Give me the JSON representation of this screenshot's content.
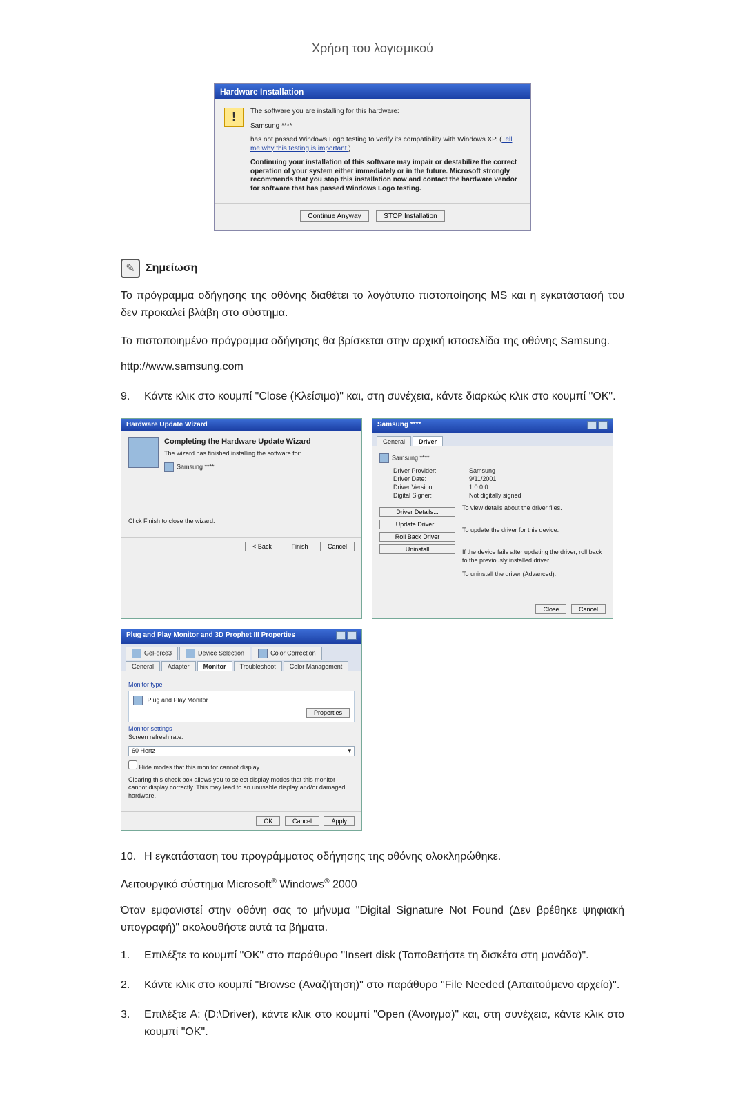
{
  "header": {
    "title": "Χρήση του λογισμικού"
  },
  "install_dialog": {
    "title": "Hardware Installation",
    "line1": "The software you are installing for this hardware:",
    "device": "Samsung ****",
    "line2a": "has not passed Windows Logo testing to verify its compatibility with Windows XP. (",
    "link": "Tell me why this testing is important.",
    "line2b": ")",
    "warn": "Continuing your installation of this software may impair or destabilize the correct operation of your system either immediately or in the future. Microsoft strongly recommends that you stop this installation now and contact the hardware vendor for software that has passed Windows Logo testing.",
    "btn_continue": "Continue Anyway",
    "btn_stop": "STOP Installation"
  },
  "note": {
    "label": "Σημείωση",
    "p1": "Το πρόγραμμα οδήγησης της οθόνης διαθέτει το λογότυπο πιστοποίησης MS και η εγκατάστασή του δεν προκαλεί βλάβη στο σύστημα.",
    "p2": "Το πιστοποιημένο πρόγραμμα οδήγησης θα βρίσκεται στην αρχική ιστοσελίδα της οθόνης Samsung.",
    "url": "http://www.samsung.com"
  },
  "step9": {
    "n": "9.",
    "t": "Κάντε κλικ στο κουμπί \"Close (Κλείσιμο)\" και, στη συνέχεια, κάντε διαρκώς κλικ στο κουμπί \"OK\"."
  },
  "wizard": {
    "title": "Hardware Update Wizard",
    "h": "Completing the Hardware Update Wizard",
    "p1": "The wizard has finished installing the software for:",
    "device": "Samsung ****",
    "p2": "Click Finish to close the wizard.",
    "back": "< Back",
    "finish": "Finish",
    "cancel": "Cancel"
  },
  "driver_props": {
    "title": "Samsung ****",
    "tab_general": "General",
    "tab_driver": "Driver",
    "device": "Samsung ****",
    "provider_k": "Driver Provider:",
    "provider_v": "Samsung",
    "date_k": "Driver Date:",
    "date_v": "9/11/2001",
    "version_k": "Driver Version:",
    "version_v": "1.0.0.0",
    "signer_k": "Digital Signer:",
    "signer_v": "Not digitally signed",
    "btn_details": "Driver Details...",
    "btn_details_t": "To view details about the driver files.",
    "btn_update": "Update Driver...",
    "btn_update_t": "To update the driver for this device.",
    "btn_rollback": "Roll Back Driver",
    "btn_rollback_t": "If the device fails after updating the driver, roll back to the previously installed driver.",
    "btn_uninstall": "Uninstall",
    "btn_uninstall_t": "To uninstall the driver (Advanced).",
    "close": "Close",
    "cancel": "Cancel"
  },
  "monitor_props": {
    "title": "Plug and Play Monitor and 3D Prophet III Properties",
    "tabs": {
      "geforce": "GeForce3",
      "device_sel": "Device Selection",
      "color_corr": "Color Correction",
      "general": "General",
      "adapter": "Adapter",
      "monitor": "Monitor",
      "troubleshoot": "Troubleshoot",
      "color_mgmt": "Color Management"
    },
    "sec_type": "Monitor type",
    "type_val": "Plug and Play Monitor",
    "btn_props": "Properties",
    "sec_settings": "Monitor settings",
    "refresh_lbl": "Screen refresh rate:",
    "refresh_val": "60 Hertz",
    "chk": "Hide modes that this monitor cannot display",
    "chk_help": "Clearing this check box allows you to select display modes that this monitor cannot display correctly. This may lead to an unusable display and/or damaged hardware.",
    "ok": "OK",
    "cancel": "Cancel",
    "apply": "Apply"
  },
  "step10": {
    "n": "10.",
    "t": "Η εγκατάσταση του προγράμματος οδήγησης της οθόνης ολοκληρώθηκε."
  },
  "os_line": {
    "pre": "Λειτουργικό σύστημα Microsoft",
    "mid": " Windows",
    "post": " 2000",
    "reg": "®"
  },
  "intro2000": "Όταν εμφανιστεί στην οθόνη σας το μήνυμα \"Digital Signature Not Found (Δεν βρέθηκε ψηφιακή υπογραφή)\" ακολουθήστε αυτά τα βήματα.",
  "s1": {
    "n": "1.",
    "t": "Επιλέξτε το κουμπί \"OK\" στο παράθυρο \"Insert disk (Τοποθετήστε τη δισκέτα στη μονάδα)\"."
  },
  "s2": {
    "n": "2.",
    "t": "Κάντε κλικ στο κουμπί \"Browse (Αναζήτηση)\" στο παράθυρο \"File Needed (Απαιτούμενο αρχείο)\"."
  },
  "s3": {
    "n": "3.",
    "t": "Επιλέξτε A: (D:\\Driver), κάντε κλικ στο κουμπί \"Open (Άνοιγμα)\" και, στη συνέχεια, κάντε κλικ στο κουμπί \"OK\"."
  }
}
